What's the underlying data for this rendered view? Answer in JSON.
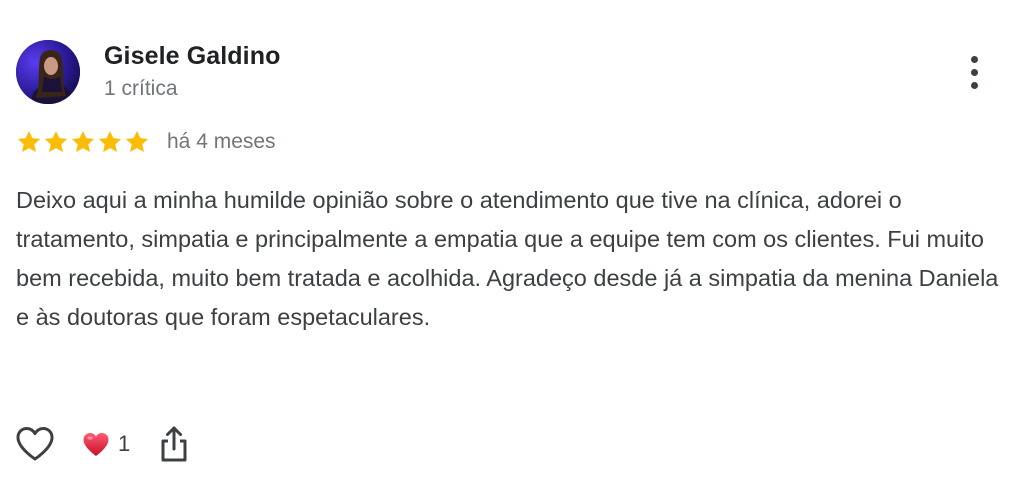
{
  "review": {
    "author_name": "Gisele Galdino",
    "author_meta": "1 crítica",
    "rating": 5,
    "rating_max": 5,
    "date": "há 4 meses",
    "text": "Deixo aqui a minha humilde opinião sobre o atendimento que tive na clínica, adorei o tratamento, simpatia e principalmente a empatia que a equipe tem com os clientes. Fui muito bem recebida, muito bem tratada e acolhida. Agradeço desde já a simpatia da menina Daniela e às doutoras que foram espetaculares.",
    "reaction_count": "1"
  },
  "icons": {
    "avatar": "avatar",
    "more": "more-vert-icon",
    "star": "star-icon",
    "like": "heart-outline-icon",
    "reaction": "red-heart-icon",
    "share": "share-icon"
  },
  "colors": {
    "star": "#fbbc04",
    "reaction": "#e0245e",
    "name": "#202124",
    "meta": "#70757a",
    "text": "#3c4043"
  }
}
